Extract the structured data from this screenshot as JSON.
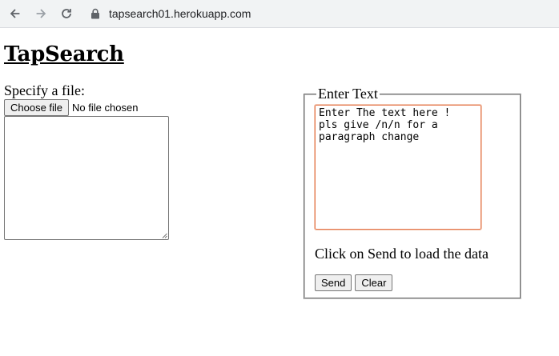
{
  "browser": {
    "url": "tapsearch01.herokuapp.com",
    "icons": [
      "back-arrow-icon",
      "forward-arrow-icon",
      "reload-icon",
      "lock-icon"
    ]
  },
  "page": {
    "title": "TapSearch",
    "file_section": {
      "label": "Specify a file:",
      "choose_button": "Choose file",
      "status": "No file chosen"
    },
    "text_section": {
      "legend": "Enter Text",
      "textarea_value": "Enter The text here !\npls give /n/n for a\nparagraph change",
      "instruction": "Click on Send to load the data",
      "send_label": "Send",
      "clear_label": "Clear"
    }
  },
  "colors": {
    "focus_border": "#e5794f",
    "toolbar_bg": "#f1f3f4"
  }
}
